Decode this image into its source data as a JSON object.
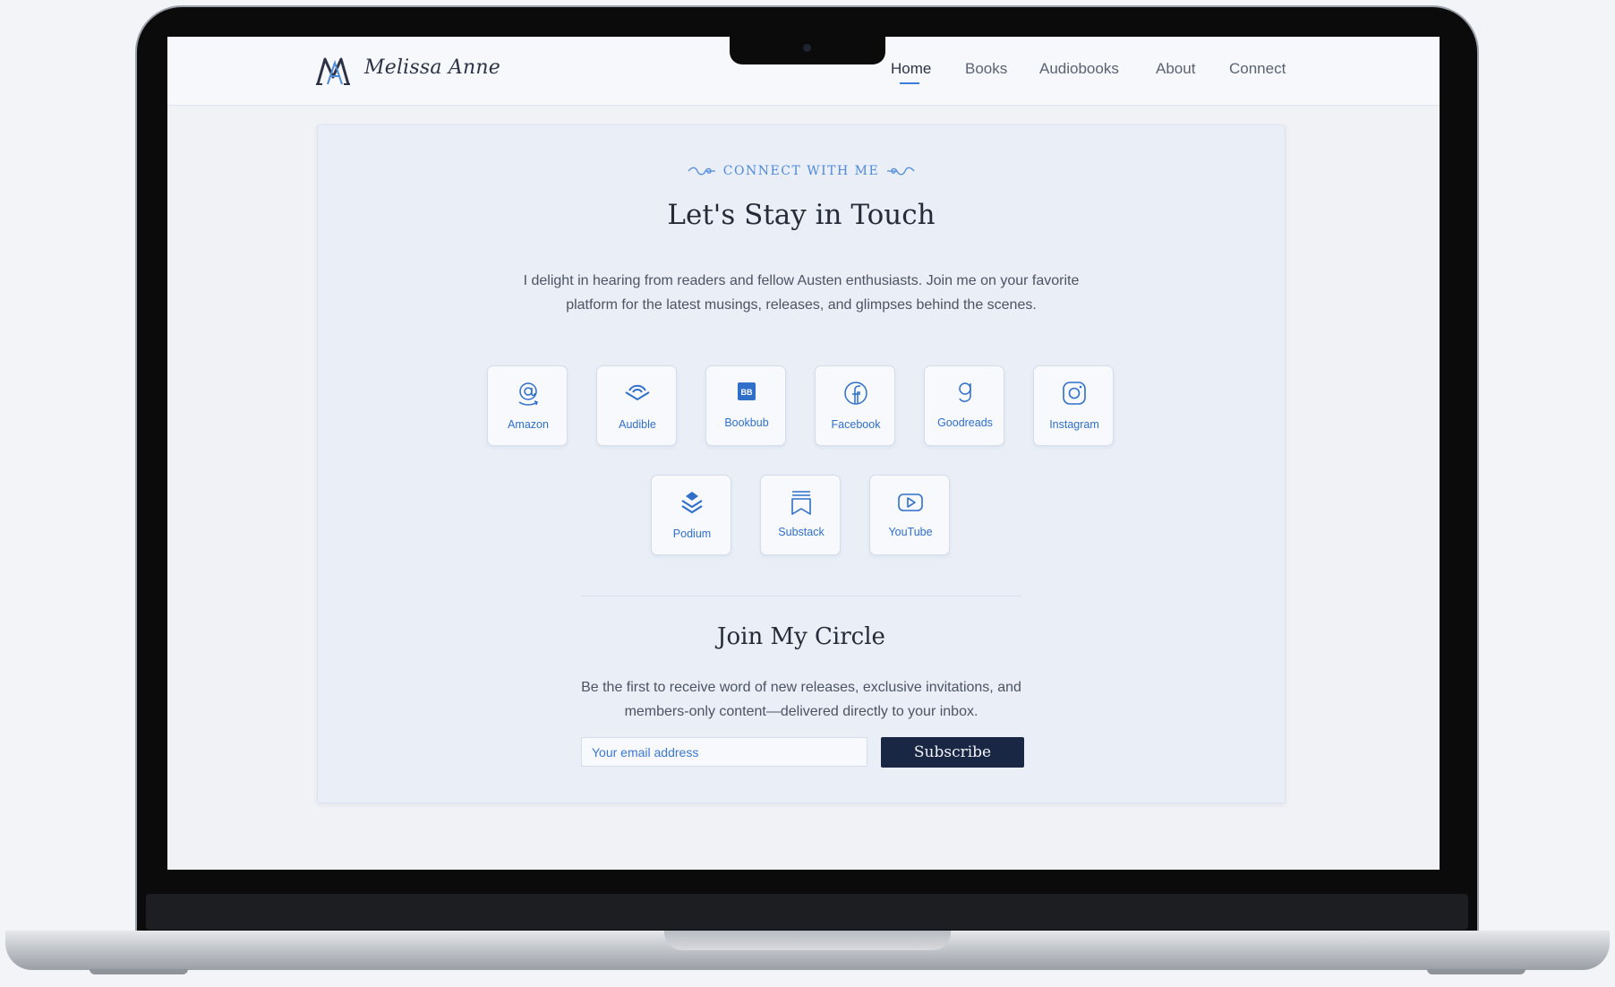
{
  "brand": {
    "name": "Melissa Anne",
    "logo_icon": "monogram-ma-icon"
  },
  "nav": {
    "items": [
      {
        "label": "Home",
        "active": true
      },
      {
        "label": "Books"
      },
      {
        "label": "Audiobooks"
      },
      {
        "label": "About"
      },
      {
        "label": "Connect"
      }
    ]
  },
  "connect": {
    "eyebrow": "CONNECT WITH ME",
    "title": "Let's Stay in Touch",
    "intro": "I delight in hearing from readers and fellow Austen enthusiasts. Join me on your favorite platform for the latest musings, releases, and glimpses behind the scenes.",
    "platforms": [
      {
        "label": "Amazon",
        "icon": "amazon-icon"
      },
      {
        "label": "Audible",
        "icon": "audible-icon"
      },
      {
        "label": "Bookbub",
        "icon": "bookbub-icon"
      },
      {
        "label": "Facebook",
        "icon": "facebook-icon"
      },
      {
        "label": "Goodreads",
        "icon": "goodreads-icon"
      },
      {
        "label": "Instagram",
        "icon": "instagram-icon"
      },
      {
        "label": "Podium",
        "icon": "podium-icon"
      },
      {
        "label": "Substack",
        "icon": "substack-icon"
      },
      {
        "label": "YouTube",
        "icon": "youtube-icon"
      }
    ]
  },
  "newsletter": {
    "title": "Join My Circle",
    "text": "Be the first to receive word of new releases, exclusive invitations, and members-only content—delivered directly to your inbox.",
    "email_placeholder": "Your email address",
    "email_value": "",
    "button_label": "Subscribe"
  },
  "colors": {
    "accent": "#3b7dd8",
    "button": "#1a2744",
    "card_bg": "#e9eef7",
    "page_bg": "#f1f2f6"
  }
}
